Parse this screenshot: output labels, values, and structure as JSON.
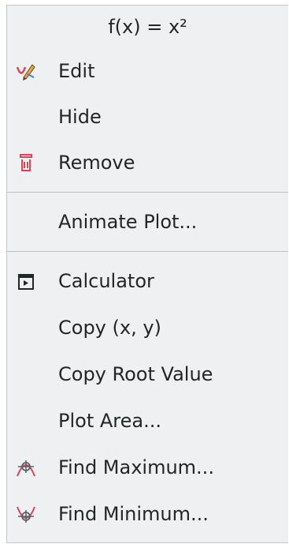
{
  "menu": {
    "title": "f(x) = x²",
    "items": {
      "edit": {
        "label": "Edit",
        "icon": "edit-plot-icon"
      },
      "hide": {
        "label": "Hide"
      },
      "remove": {
        "label": "Remove",
        "icon": "trash-icon"
      },
      "animate": {
        "label": "Animate Plot..."
      },
      "calculator": {
        "label": "Calculator",
        "icon": "calculator-icon"
      },
      "copy_xy": {
        "label": "Copy (x, y)"
      },
      "copy_root": {
        "label": "Copy Root Value"
      },
      "plot_area": {
        "label": "Plot Area..."
      },
      "find_max": {
        "label": "Find Maximum...",
        "icon": "find-maximum-icon"
      },
      "find_min": {
        "label": "Find Minimum...",
        "icon": "find-minimum-icon"
      }
    }
  },
  "colors": {
    "menu_bg": "#eff0f1",
    "text": "#232627",
    "separator": "#bfc2c5",
    "remove_icon": "#da4453",
    "curve_icon": "#da4453"
  }
}
